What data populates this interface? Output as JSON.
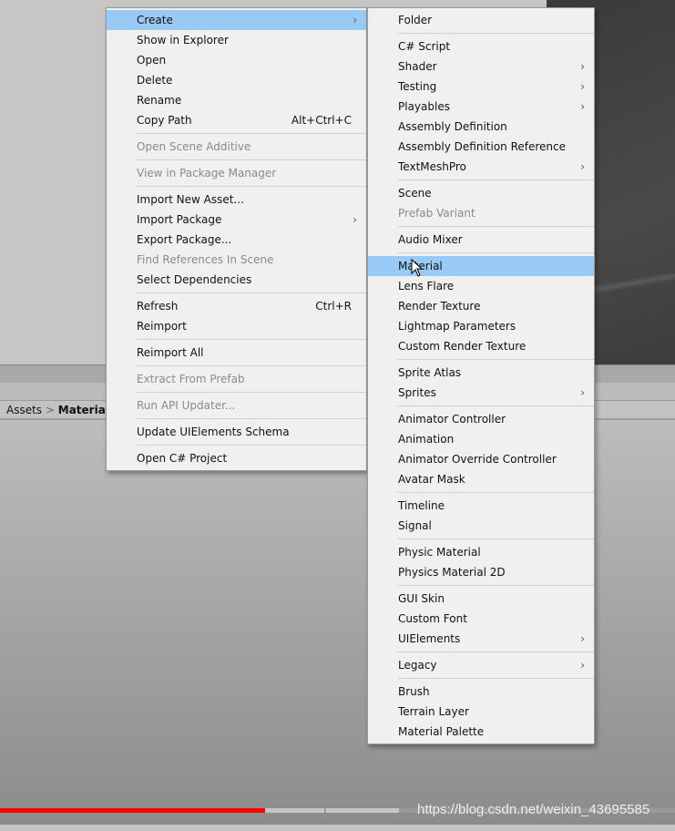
{
  "project": {
    "breadcrumb": [
      "Assets",
      "Materials"
    ],
    "search_icon": "search-icon"
  },
  "watermark": "https://blog.csdn.net/weixin_43695585",
  "video": {
    "progress_percent": 39.3
  },
  "context_menu": [
    {
      "label": "Create",
      "submenu": true,
      "highlighted": true
    },
    {
      "label": "Show in Explorer"
    },
    {
      "label": "Open"
    },
    {
      "label": "Delete"
    },
    {
      "label": "Rename"
    },
    {
      "label": "Copy Path",
      "shortcut": "Alt+Ctrl+C"
    },
    {
      "sep": true
    },
    {
      "label": "Open Scene Additive",
      "disabled": true
    },
    {
      "sep": true
    },
    {
      "label": "View in Package Manager",
      "disabled": true
    },
    {
      "sep": true
    },
    {
      "label": "Import New Asset..."
    },
    {
      "label": "Import Package",
      "submenu": true
    },
    {
      "label": "Export Package..."
    },
    {
      "label": "Find References In Scene",
      "disabled": true
    },
    {
      "label": "Select Dependencies"
    },
    {
      "sep": true
    },
    {
      "label": "Refresh",
      "shortcut": "Ctrl+R"
    },
    {
      "label": "Reimport"
    },
    {
      "sep": true
    },
    {
      "label": "Reimport All"
    },
    {
      "sep": true
    },
    {
      "label": "Extract From Prefab",
      "disabled": true
    },
    {
      "sep": true
    },
    {
      "label": "Run API Updater...",
      "disabled": true
    },
    {
      "sep": true
    },
    {
      "label": "Update UIElements Schema"
    },
    {
      "sep": true
    },
    {
      "label": "Open C# Project"
    }
  ],
  "create_submenu": [
    {
      "label": "Folder"
    },
    {
      "sep": true
    },
    {
      "label": "C# Script"
    },
    {
      "label": "Shader",
      "submenu": true
    },
    {
      "label": "Testing",
      "submenu": true
    },
    {
      "label": "Playables",
      "submenu": true
    },
    {
      "label": "Assembly Definition"
    },
    {
      "label": "Assembly Definition Reference"
    },
    {
      "label": "TextMeshPro",
      "submenu": true
    },
    {
      "sep": true
    },
    {
      "label": "Scene"
    },
    {
      "label": "Prefab Variant",
      "disabled": true
    },
    {
      "sep": true
    },
    {
      "label": "Audio Mixer"
    },
    {
      "sep": true
    },
    {
      "label": "Material",
      "highlighted": true
    },
    {
      "label": "Lens Flare"
    },
    {
      "label": "Render Texture"
    },
    {
      "label": "Lightmap Parameters"
    },
    {
      "label": "Custom Render Texture"
    },
    {
      "sep": true
    },
    {
      "label": "Sprite Atlas"
    },
    {
      "label": "Sprites",
      "submenu": true
    },
    {
      "sep": true
    },
    {
      "label": "Animator Controller"
    },
    {
      "label": "Animation"
    },
    {
      "label": "Animator Override Controller"
    },
    {
      "label": "Avatar Mask"
    },
    {
      "sep": true
    },
    {
      "label": "Timeline"
    },
    {
      "label": "Signal"
    },
    {
      "sep": true
    },
    {
      "label": "Physic Material"
    },
    {
      "label": "Physics Material 2D"
    },
    {
      "sep": true
    },
    {
      "label": "GUI Skin"
    },
    {
      "label": "Custom Font"
    },
    {
      "label": "UIElements",
      "submenu": true
    },
    {
      "sep": true
    },
    {
      "label": "Legacy",
      "submenu": true
    },
    {
      "sep": true
    },
    {
      "label": "Brush"
    },
    {
      "label": "Terrain Layer"
    },
    {
      "label": "Material Palette"
    }
  ],
  "colors": {
    "highlight": "#99c9f5",
    "progress": "#ff0000"
  }
}
